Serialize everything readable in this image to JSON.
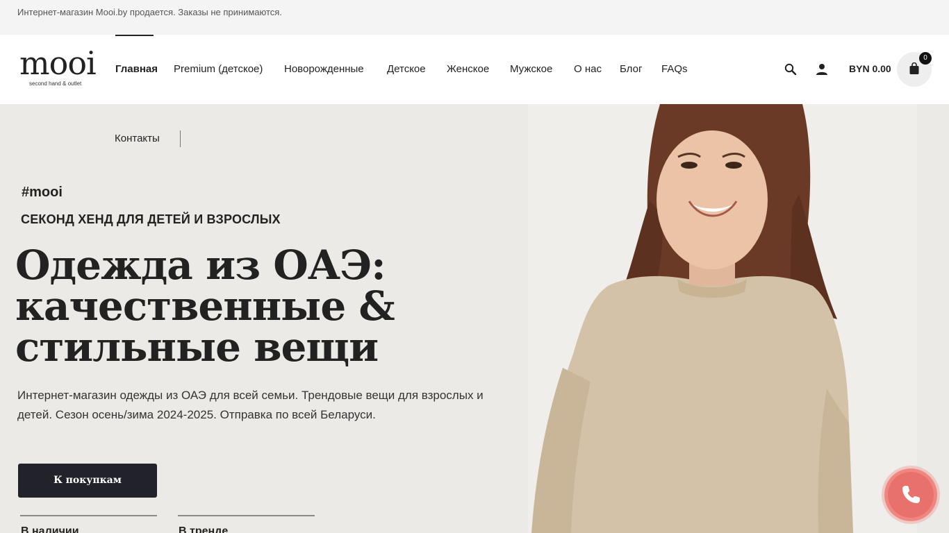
{
  "topbar": {
    "notice": "Интернет-магазин Mooi.by продается. Заказы не принимаются."
  },
  "logo": {
    "word": "mooi",
    "tagline": "second hand & outlet"
  },
  "nav": {
    "items": [
      {
        "label": "Главная",
        "active": true
      },
      {
        "label": "Premium (детское)"
      },
      {
        "label": "Новорожденные"
      },
      {
        "label": "Детское"
      },
      {
        "label": "Женское"
      },
      {
        "label": "Мужское"
      },
      {
        "label": "О нас"
      },
      {
        "label": "Блог"
      },
      {
        "label": "FAQs"
      }
    ],
    "second_row": [
      {
        "label": "Контакты"
      }
    ]
  },
  "header_actions": {
    "search_icon": "search-icon",
    "account_icon": "user-icon",
    "cart_total": "BYN 0.00",
    "cart_icon": "shopping-bag-icon",
    "cart_count": "0"
  },
  "hero": {
    "hashtag": "#mooi",
    "kicker": "СЕКОНД ХЕНД ДЛЯ ДЕТЕЙ И ВЗРОСЛЫХ",
    "headline": [
      "Одежда из ОАЭ:",
      "качественные &",
      "стильные вещи"
    ],
    "lead": "Интернет-магазин одежды из ОАЭ для всей семьи. Трендовые вещи для взрослых и детей. Сезон осень/зима 2024-2025. Отправка по всей Беларуси.",
    "cta_label": "К покупкам",
    "tabs": [
      {
        "label": "В наличии"
      },
      {
        "label": "В тренде"
      }
    ]
  },
  "call_widget": {
    "icon": "phone-icon"
  },
  "colors": {
    "topbar_bg": "#f4f4f4",
    "hero_bg": "#ebeae6",
    "cta_bg": "#22232a",
    "call_button": "#e8716b",
    "sweater": "#d4c2a8",
    "hair": "#6b3a26"
  }
}
